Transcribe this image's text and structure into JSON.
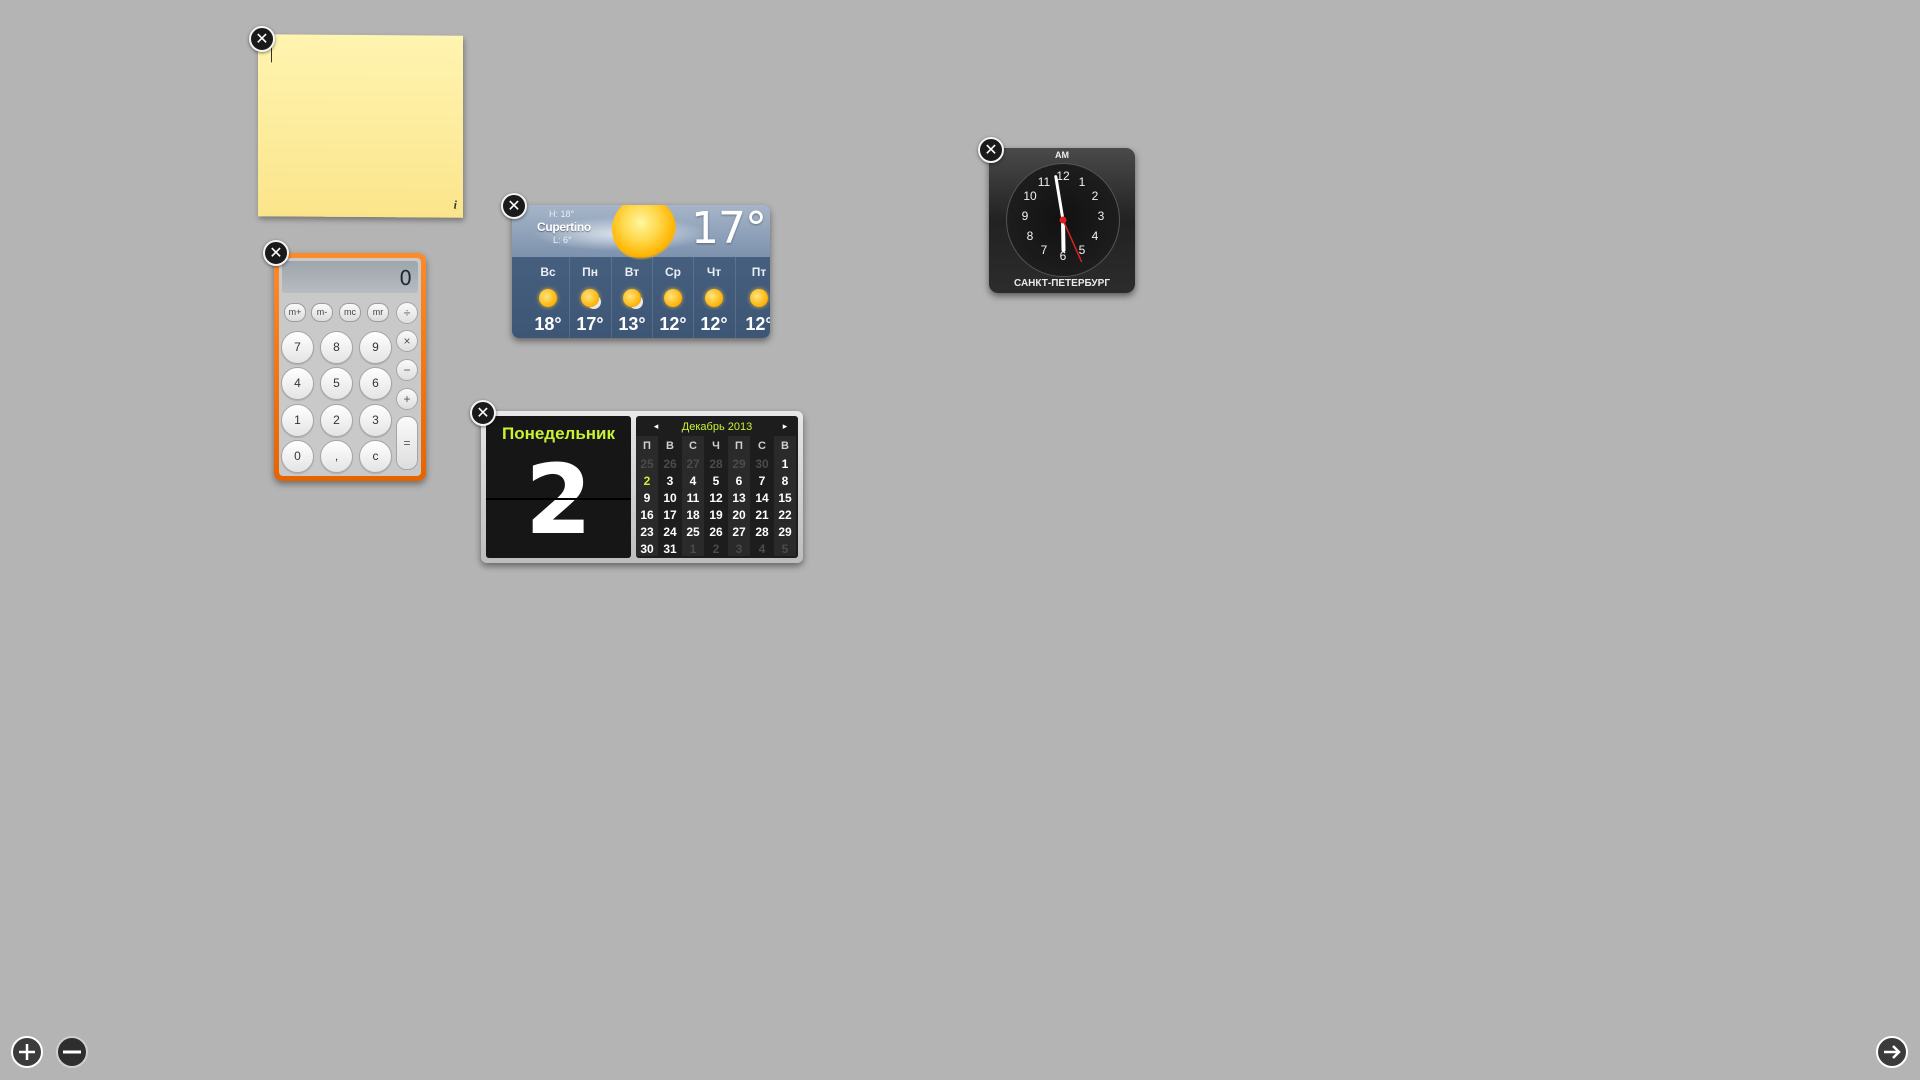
{
  "widgets": {
    "stickies": {
      "close": "✕",
      "info": "i"
    },
    "calculator": {
      "close": "✕",
      "display": "0",
      "memory_keys": [
        "m+",
        "m-",
        "mc",
        "mr"
      ],
      "op_divide": "÷",
      "op_multiply": "×",
      "op_minus": "−",
      "op_plus": "+",
      "op_equals": "=",
      "digit_keys": [
        "7",
        "8",
        "9",
        "4",
        "5",
        "6",
        "1",
        "2",
        "3",
        "0",
        ",",
        "c"
      ]
    },
    "weather": {
      "close": "✕",
      "high": "H: 18°",
      "city": "Cupertino",
      "low": "L: 6°",
      "current_temp": "17°",
      "forecast": [
        {
          "day": "Вс",
          "temp": "18°",
          "icon": "sun-icon"
        },
        {
          "day": "Пн",
          "temp": "17°",
          "icon": "partly-cloudy-icon"
        },
        {
          "day": "Вт",
          "temp": "13°",
          "icon": "partly-cloudy-icon"
        },
        {
          "day": "Ср",
          "temp": "12°",
          "icon": "sun-icon"
        },
        {
          "day": "Чт",
          "temp": "12°",
          "icon": "sun-icon"
        },
        {
          "day": "Пт",
          "temp": "12°",
          "icon": "sun-icon"
        }
      ]
    },
    "world_clock": {
      "close": "✕",
      "meridiem": "AM",
      "numbers": [
        "12",
        "1",
        "2",
        "3",
        "4",
        "5",
        "6",
        "7",
        "8",
        "9",
        "10",
        "11"
      ],
      "city": "САНКТ-ПЕТЕРБУРГ",
      "time": {
        "hour": 5,
        "minute": 58,
        "second": 26
      }
    },
    "calendar": {
      "close": "✕",
      "weekday": "Понедельник",
      "day": "2",
      "month_title": "Декабрь 2013",
      "prev": "◂",
      "next": "▸",
      "weekday_headers": [
        "П",
        "В",
        "С",
        "Ч",
        "П",
        "С",
        "В"
      ],
      "weeks": [
        [
          "25",
          "26",
          "27",
          "28",
          "29",
          "30",
          "1"
        ],
        [
          "2",
          "3",
          "4",
          "5",
          "6",
          "7",
          "8"
        ],
        [
          "9",
          "10",
          "11",
          "12",
          "13",
          "14",
          "15"
        ],
        [
          "16",
          "17",
          "18",
          "19",
          "20",
          "21",
          "22"
        ],
        [
          "23",
          "24",
          "25",
          "26",
          "27",
          "28",
          "29"
        ],
        [
          "30",
          "31",
          "1",
          "2",
          "3",
          "4",
          "5"
        ]
      ]
    }
  },
  "controls": {
    "add_widget": "plus-icon",
    "remove_widget": "minus-icon",
    "next": "arrow-right-icon"
  },
  "colors": {
    "background": "#b4b4b4",
    "calendar_accent": "#c9f233",
    "calculator_orange": "#ff8a2a"
  }
}
